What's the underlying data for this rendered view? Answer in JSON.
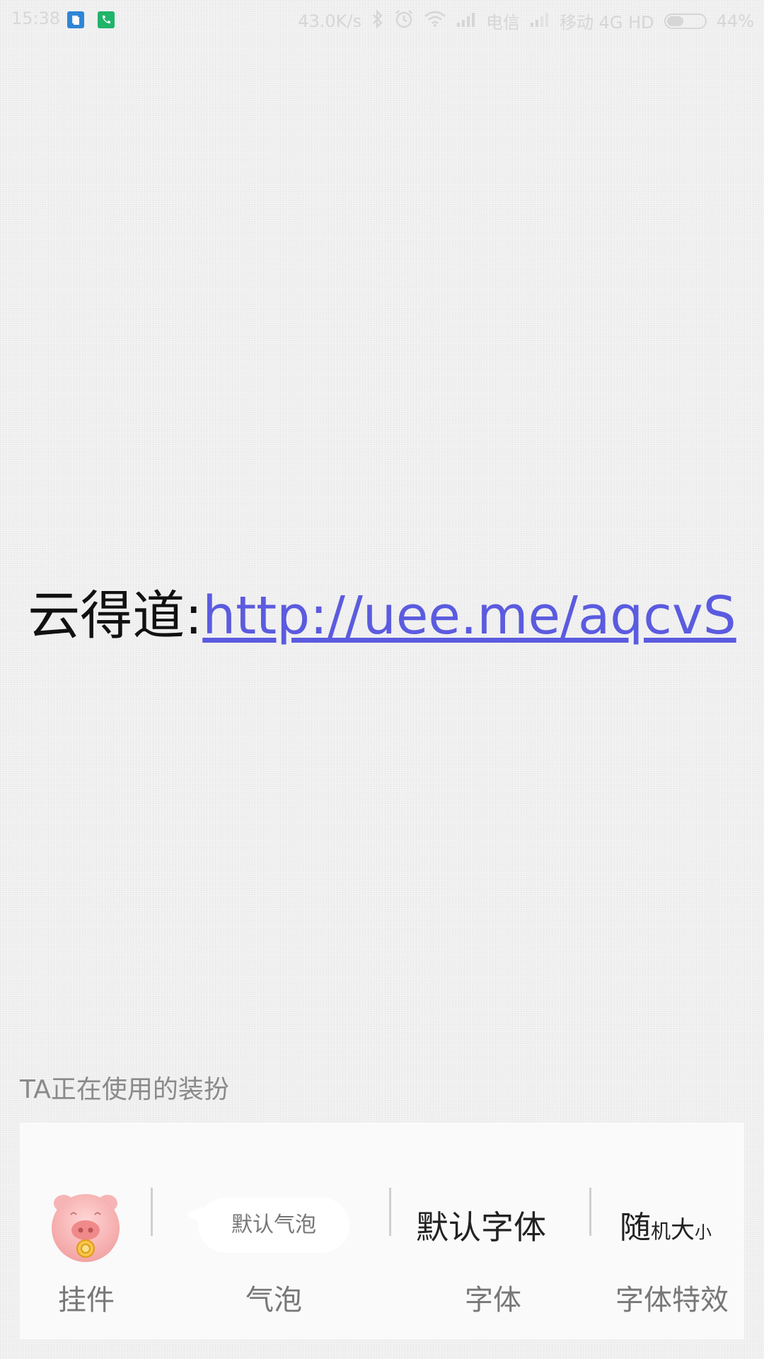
{
  "status_bar": {
    "time": "15:38",
    "network_speed": "43.0K/s",
    "carrier1": "电信",
    "carrier2": "移动 4G HD",
    "battery": "44%",
    "battery_level": 0.44,
    "icons": [
      "doc-icon",
      "phone-icon",
      "bluetooth-icon",
      "alarm-icon",
      "wifi-icon",
      "signal-icon",
      "signal-icon",
      "battery-icon"
    ]
  },
  "message": {
    "prefix": "云得道:",
    "link": "http://uee.me/aqcvS",
    "link_color": "#5b5be0"
  },
  "decor_section": {
    "title": "TA正在使用的装扮",
    "items": [
      {
        "label": "挂件",
        "preview_icon": "pig-pendant-icon"
      },
      {
        "label": "气泡",
        "preview_text": "默认气泡"
      },
      {
        "label": "字体",
        "preview_text": "默认字体"
      },
      {
        "label": "字体特效",
        "preview_parts": [
          "随",
          "机",
          "大",
          "小"
        ]
      }
    ]
  }
}
